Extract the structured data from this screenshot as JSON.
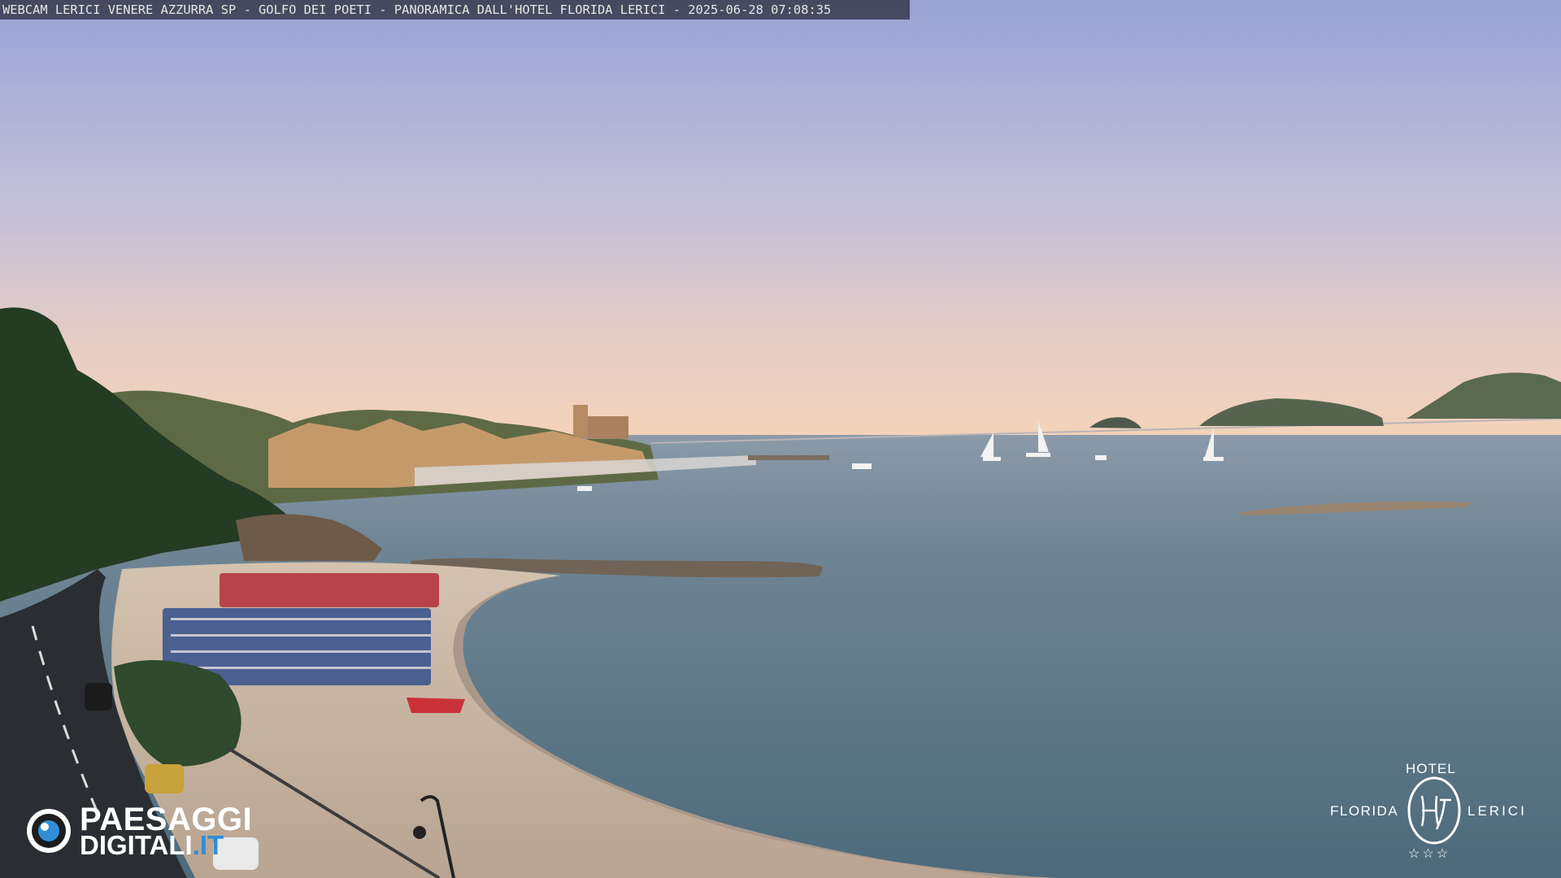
{
  "caption": "WEBCAM LERICI VENERE AZZURRA SP - GOLFO DEI POETI - PANORAMICA DALL'HOTEL FLORIDA LERICI - 2025-06-28 07:08:35",
  "watermark_left": {
    "line1": "PAESAGGI",
    "line2": "DIGITALI",
    "line2_suffix": ".IT",
    "icon": "eye-lens-icon"
  },
  "watermark_right": {
    "top": "HOTEL",
    "left": "FLORIDA",
    "right": "LERICI",
    "stars": "☆☆☆",
    "emblem": "hf-monogram-icon"
  },
  "colors": {
    "sky_top": "#9ea6d8",
    "sky_horizon": "#f0cdb4",
    "sea": "#5f7b8c",
    "sand": "#c9b8a5",
    "accent_logo": "#2f8fd6"
  }
}
